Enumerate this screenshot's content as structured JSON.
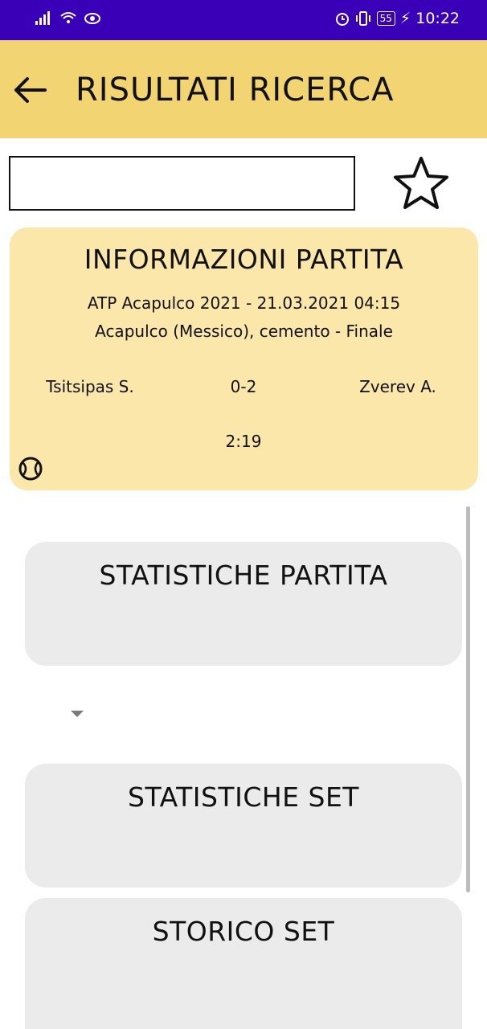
{
  "status_bar": {
    "time": "10:22",
    "battery": "55"
  },
  "app_bar": {
    "title": "RISULTATI RICERCA"
  },
  "search": {
    "value": "",
    "placeholder": ""
  },
  "match_info": {
    "title": "INFORMAZIONI PARTITA",
    "tournament_line": "ATP Acapulco 2021 - 21.03.2021 04:15",
    "location_line": "Acapulco (Messico), cemento - Finale",
    "player1": "Tsitsipas S.",
    "score": "0-2",
    "player2": "Zverev A.",
    "duration": "2:19"
  },
  "sections": {
    "match_stats": "STATISTICHE PARTITA",
    "set_stats": "STATISTICHE SET",
    "set_history": "STORICO SET"
  }
}
